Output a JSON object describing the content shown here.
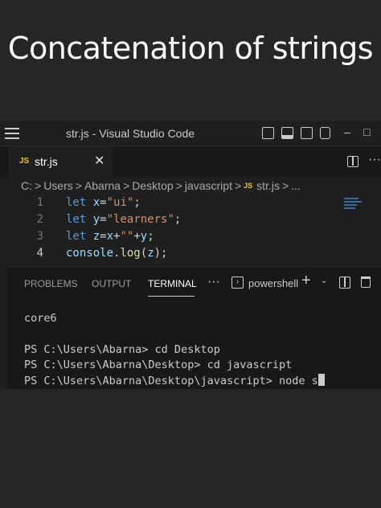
{
  "overlay": {
    "heading": "Concatenation of strings"
  },
  "titlebar": {
    "title": "str.js - Visual Studio Code",
    "minimize": "–",
    "maximize": "□"
  },
  "tab": {
    "badge": "JS",
    "label": "str.js",
    "close": "✕"
  },
  "tabbar": {
    "more": "···"
  },
  "breadcrumb": {
    "items": [
      "C:",
      "Users",
      "Abarna",
      "Desktop",
      "javascript"
    ],
    "file_badge": "JS",
    "file": "str.js",
    "more": "...",
    "separator": ">"
  },
  "editor": {
    "current_line": 4,
    "lines": [
      {
        "number": "1",
        "tokens": [
          [
            "kw",
            "let"
          ],
          [
            "op",
            " "
          ],
          [
            "var",
            "x"
          ],
          [
            "op",
            "="
          ],
          [
            "str",
            "\"ui\""
          ],
          [
            "op",
            ";"
          ]
        ]
      },
      {
        "number": "2",
        "tokens": [
          [
            "kw",
            "let"
          ],
          [
            "op",
            " "
          ],
          [
            "var",
            "y"
          ],
          [
            "op",
            "="
          ],
          [
            "str",
            "\"learners\""
          ],
          [
            "op",
            ";"
          ]
        ]
      },
      {
        "number": "3",
        "tokens": [
          [
            "kw",
            "let"
          ],
          [
            "op",
            " "
          ],
          [
            "var",
            "z"
          ],
          [
            "op",
            "="
          ],
          [
            "var",
            "x"
          ],
          [
            "op",
            "+"
          ],
          [
            "str",
            "\"\""
          ],
          [
            "op",
            "+"
          ],
          [
            "var",
            "y"
          ],
          [
            "op",
            ";"
          ]
        ]
      },
      {
        "number": "4",
        "tokens": [
          [
            "var",
            "console"
          ],
          [
            "op",
            "."
          ],
          [
            "fn",
            "log"
          ],
          [
            "op",
            "("
          ],
          [
            "var",
            "z"
          ],
          [
            "op",
            ");"
          ]
        ]
      }
    ]
  },
  "panel": {
    "tabs": [
      "PROBLEMS",
      "OUTPUT",
      "TERMINAL"
    ],
    "active_tab": "TERMINAL",
    "more": "···",
    "shell_icon": "›",
    "shell": "powershell",
    "add": "+",
    "dropdown": "⌄"
  },
  "terminal": {
    "lines": [
      "core6",
      "",
      "PS C:\\Users\\Abarna> cd Desktop",
      "PS C:\\Users\\Abarna\\Desktop> cd javascript",
      "PS C:\\Users\\Abarna\\Desktop\\javascript> node s"
    ]
  },
  "colors": {
    "accent_js": "#e8c547",
    "keyword": "#569cd6",
    "string": "#ce9178",
    "variable": "#9cdcfe"
  }
}
